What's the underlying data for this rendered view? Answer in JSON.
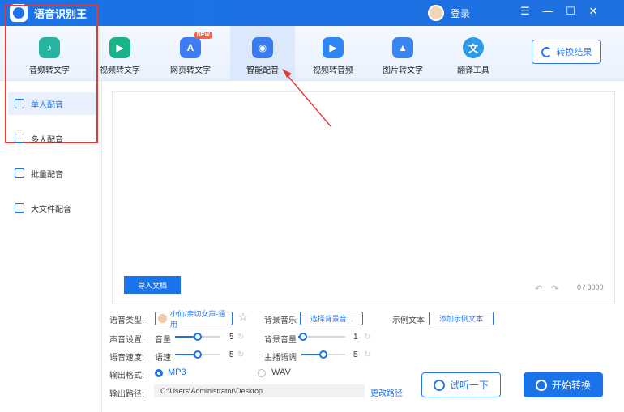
{
  "app": {
    "title": "语音识别王",
    "login": "登录",
    "window_controls": [
      "☰",
      "—",
      "☐",
      "✕"
    ]
  },
  "toolbar": {
    "tools": [
      {
        "label": "音频转文字",
        "icon": "audio-to-text-icon",
        "color": "#26b3a0"
      },
      {
        "label": "视频转文字",
        "icon": "video-to-text-icon",
        "color": "#19b38a"
      },
      {
        "label": "网页转文字",
        "icon": "webpage-to-text-icon",
        "color": "#3d7cf5",
        "badge": "NEW"
      },
      {
        "label": "智能配音",
        "icon": "smart-dubbing-icon",
        "color": "#3a7bf0"
      },
      {
        "label": "视频转音频",
        "icon": "video-to-audio-icon",
        "color": "#2f86f5"
      },
      {
        "label": "图片转文字",
        "icon": "image-to-text-icon",
        "color": "#3a84f0"
      },
      {
        "label": "翻译工具",
        "icon": "translate-icon",
        "color": "#2c9be8"
      }
    ],
    "active_index": 3,
    "convert_result": "转换结果"
  },
  "sidebar": {
    "items": [
      {
        "label": "单人配音",
        "active": true
      },
      {
        "label": "多人配音"
      },
      {
        "label": "批量配音"
      },
      {
        "label": "大文件配音"
      }
    ]
  },
  "editor": {
    "import_label": "导入文档",
    "counter": "0 / 3000"
  },
  "settings": {
    "voice_type_label": "语音类型:",
    "voice_name": "小仙/亲切女声-通用",
    "bg_music_label": "背景音乐",
    "bg_music_button": "选择背景音...",
    "sample_label": "示例文本",
    "sample_button": "添加示例文本",
    "sound_setting_label": "声音设置:",
    "volume_label": "音量",
    "volume_value": "5",
    "bg_volume_label": "背景音量",
    "bg_volume_value": "1",
    "speed_setting_label": "语音速度:",
    "speed_label": "语速",
    "speed_value": "5",
    "tone_label": "主播语调",
    "tone_value": "5",
    "format_label": "输出格式:",
    "format_mp3": "MP3",
    "format_wav": "WAV",
    "path_label": "输出路径:",
    "path_value": "C:\\Users\\Administrator\\Desktop",
    "change_path": "更改路径"
  },
  "actions": {
    "listen": "试听一下",
    "start": "开始转换"
  },
  "levels": {
    "volume": 0.5,
    "bg_volume": 0.1,
    "speed": 0.5,
    "tone": 0.5
  },
  "colors": {
    "primary": "#1a73e8",
    "highlight_box": "#e53935"
  }
}
